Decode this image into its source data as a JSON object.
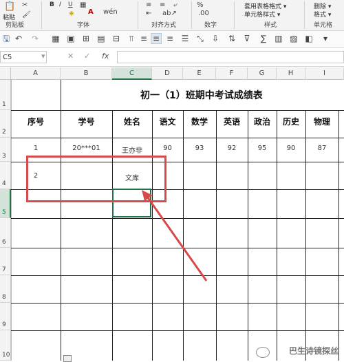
{
  "ribbon": {
    "paste_label": "粘贴",
    "groups": [
      "剪贴板",
      "字体",
      "对齐方式",
      "数字",
      "样式",
      "单元格"
    ],
    "style_items": [
      "套用表格格式 ▾",
      "单元格样式 ▾"
    ],
    "cell_items": [
      "删除 ▾",
      "格式 ▾"
    ],
    "font_buttons": [
      "B",
      "I",
      "U"
    ]
  },
  "namebox": {
    "value": "C5"
  },
  "formula_bar": {
    "cancel": "✕",
    "confirm": "✓",
    "fx": "fx"
  },
  "columns": [
    "A",
    "B",
    "C",
    "D",
    "E",
    "F",
    "G",
    "H",
    "I"
  ],
  "rows": [
    "1",
    "2",
    "3",
    "4",
    "5",
    "6",
    "7",
    "8",
    "9",
    "10"
  ],
  "sheet": {
    "title": "初一（1）班期中考试成绩表",
    "headers": [
      "序号",
      "学号",
      "姓名",
      "语文",
      "数学",
      "英语",
      "政治",
      "历史",
      "物理"
    ],
    "row3": [
      "1",
      "20***01",
      "王亦非",
      "90",
      "93",
      "92",
      "95",
      "90",
      "87"
    ],
    "row4": {
      "seq": "2",
      "name": "文库"
    }
  },
  "watermark": "巴生诗镜探丝",
  "colors": {
    "accent": "#217346",
    "annotation": "#d64a4a"
  }
}
